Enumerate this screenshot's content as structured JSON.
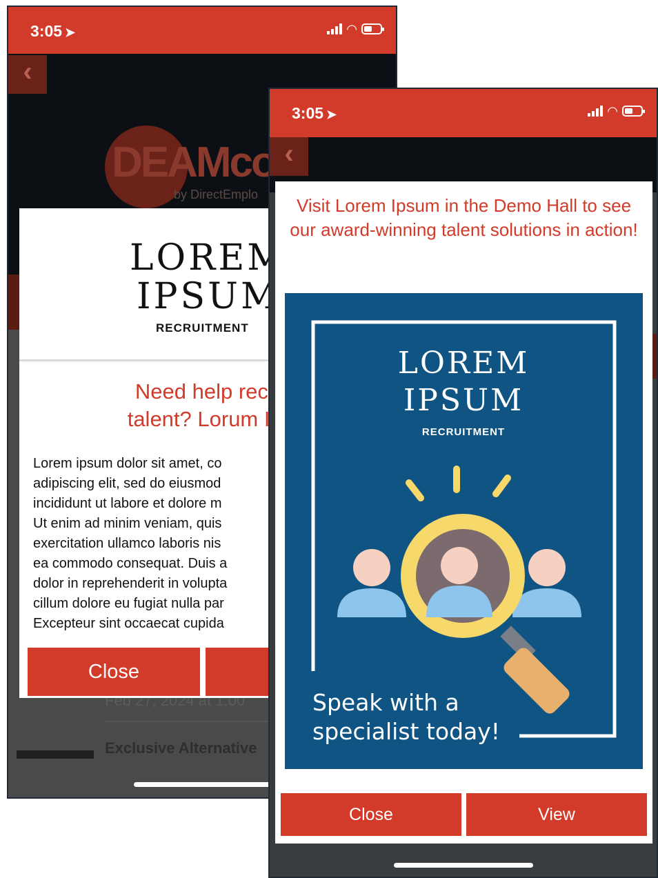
{
  "phone_left": {
    "status": {
      "time": "3:05",
      "location_icon": "location-arrow-icon",
      "icons": [
        "signal-icon",
        "wifi-icon",
        "battery-icon"
      ]
    },
    "background_app": {
      "logo_text": "DEAMco",
      "logo_subtitle": "by DirectEmplo",
      "list_date": "Feb 27, 2024 at 1:00",
      "list_title": "Exclusive Alternative"
    },
    "modal": {
      "logo_line1": "LOREM",
      "logo_line2": "IPSUM",
      "logo_line3": "RECRUITMENT",
      "headline_line1": "Need help recruitin",
      "headline_line2": "talent? Lorum Ipsum",
      "body_lines": [
        "Lorem ipsum dolor sit amet, co",
        "adipiscing elit, sed do eiusmod",
        "incididunt ut labore et dolore m",
        "Ut enim ad minim veniam, quis",
        "exercitation ullamco laboris nis",
        "ea commodo consequat. Duis a",
        "dolor in reprehenderit in volupta",
        "cillum dolore eu fugiat nulla par",
        "Excepteur sint occaecat cupida"
      ],
      "close_label": "Close"
    }
  },
  "phone_right": {
    "status": {
      "time": "3:05",
      "location_icon": "location-arrow-icon",
      "icons": [
        "signal-icon",
        "wifi-icon",
        "battery-icon"
      ]
    },
    "modal": {
      "title": "Visit Lorem Ipsum in the Demo Hall to see our award-winning talent solutions in action!",
      "poster": {
        "line1": "LOREM",
        "line2": "IPSUM",
        "line3": "RECRUITMENT",
        "tagline1": "Speak with a",
        "tagline2": "specialist today!",
        "icon": "magnifier-people-icon"
      },
      "close_label": "Close",
      "view_label": "View"
    }
  },
  "colors": {
    "accent": "#d23b2a",
    "poster_bg": "#0f5483",
    "magnifier": "#f6d86b",
    "person": "#8ec5ec"
  }
}
